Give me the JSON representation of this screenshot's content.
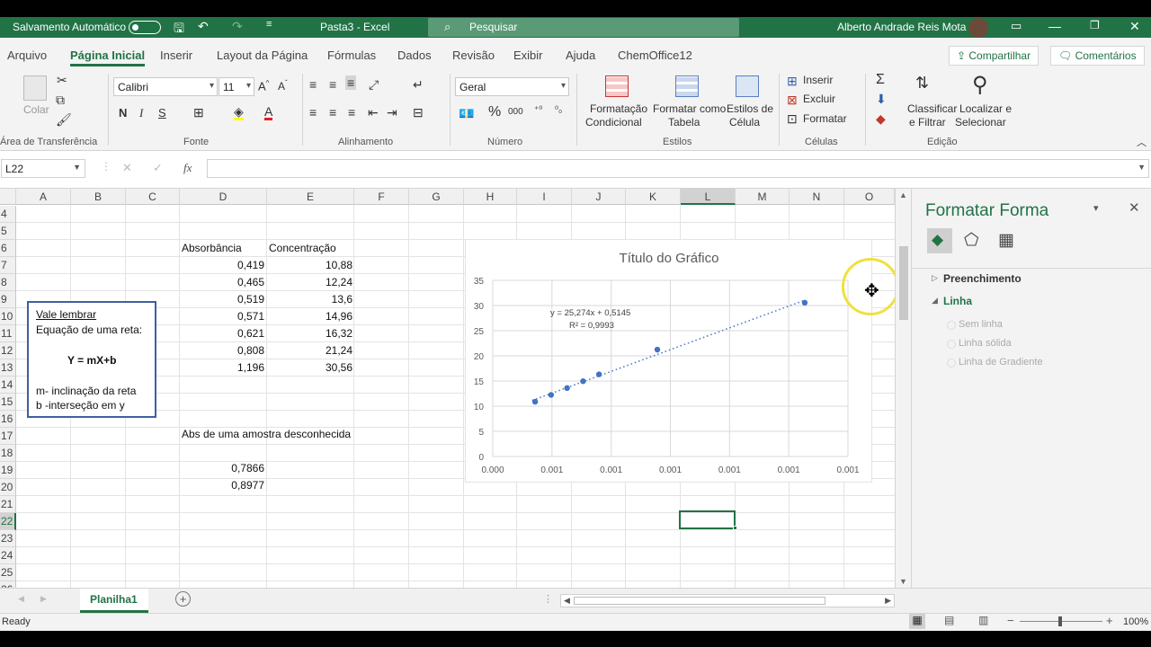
{
  "titlebar": {
    "autosave": "Salvamento Automático",
    "doc": "Pasta3  -  Excel",
    "search": "Pesquisar",
    "user": "Alberto Andrade Reis Mota"
  },
  "menu": {
    "items": [
      "Arquivo",
      "Página Inicial",
      "Inserir",
      "Layout da Página",
      "Fórmulas",
      "Dados",
      "Revisão",
      "Exibir",
      "Ajuda",
      "ChemOffice12"
    ],
    "share": "Compartilhar",
    "comments": "Comentários"
  },
  "ribbon": {
    "paste": "Colar",
    "clipboard": "Área de Transferência",
    "font_name": "Calibri",
    "font_size": "11",
    "bold": "N",
    "italic": "I",
    "underline": "S",
    "font_group": "Fonte",
    "align_group": "Alinhamento",
    "number_format": "Geral",
    "number_group": "Número",
    "cond_fmt_1": "Formatação",
    "cond_fmt_2": "Condicional",
    "fmt_table_1": "Formatar como",
    "fmt_table_2": "Tabela",
    "cell_styles_1": "Estilos de",
    "cell_styles_2": "Célula",
    "styles_group": "Estilos",
    "insert": "Inserir",
    "delete": "Excluir",
    "format": "Formatar",
    "cells_group": "Células",
    "sort_1": "Classificar",
    "sort_2": "e Filtrar",
    "find_1": "Localizar e",
    "find_2": "Selecionar",
    "editing_group": "Edição"
  },
  "formula_bar": {
    "namebox": "L22",
    "content": ""
  },
  "columns": [
    "A",
    "B",
    "C",
    "D",
    "E",
    "F",
    "G",
    "H",
    "I",
    "J",
    "K",
    "L",
    "M",
    "N",
    "O"
  ],
  "rows": [
    "4",
    "5",
    "6",
    "7",
    "8",
    "9",
    "10",
    "11",
    "12",
    "13",
    "14",
    "15",
    "16",
    "17",
    "18",
    "19",
    "20",
    "21",
    "22",
    "23",
    "24",
    "25",
    "26"
  ],
  "table": {
    "header_abs": "Absorbância",
    "header_conc": "Concentração",
    "abs": [
      "0,419",
      "0,465",
      "0,519",
      "0,571",
      "0,621",
      "0,808",
      "1,196"
    ],
    "conc": [
      "10,88",
      "12,24",
      "13,6",
      "14,96",
      "16,32",
      "21,24",
      "30,56"
    ],
    "unknown_label": "Abs de uma amostra desconhecida",
    "unknown": [
      "0,7866",
      "0,8977"
    ]
  },
  "textbox": {
    "title": "Vale lembrar",
    "line1": "Equação de uma reta:",
    "formula": "Y = mX+b",
    "m": "m- inclinação da reta",
    "b": "b -interseção em y"
  },
  "chart_data": {
    "type": "scatter",
    "title": "Título do Gráfico",
    "equation": "y = 25,274x + 0,5145",
    "r2": "R² = 0,9993",
    "x_tick_labels": [
      "0.000",
      "0.001",
      "0.001",
      "0.001",
      "0.001",
      "0.001",
      "0.001"
    ],
    "y_ticks": [
      0,
      5,
      10,
      15,
      20,
      25,
      30,
      35
    ],
    "xlim": [
      0,
      0.0012
    ],
    "ylim": [
      0,
      35
    ],
    "points": [
      {
        "x": 0.000143,
        "y": 10.88
      },
      {
        "x": 0.000197,
        "y": 12.24
      },
      {
        "x": 0.000251,
        "y": 13.6
      },
      {
        "x": 0.000305,
        "y": 14.96
      },
      {
        "x": 0.000359,
        "y": 16.32
      },
      {
        "x": 0.000556,
        "y": 21.24
      },
      {
        "x": 0.001054,
        "y": 30.56
      }
    ],
    "trendline": "dotted",
    "color": "#4472c4"
  },
  "pane": {
    "title": "Formatar Forma",
    "fill": "Preenchimento",
    "line": "Linha",
    "opt1": "Sem linha",
    "opt2": "Linha sólida",
    "opt3": "Linha de Gradiente"
  },
  "sheet_tab": "Planilha1",
  "status": {
    "ready": "Ready",
    "zoom": "100%"
  }
}
